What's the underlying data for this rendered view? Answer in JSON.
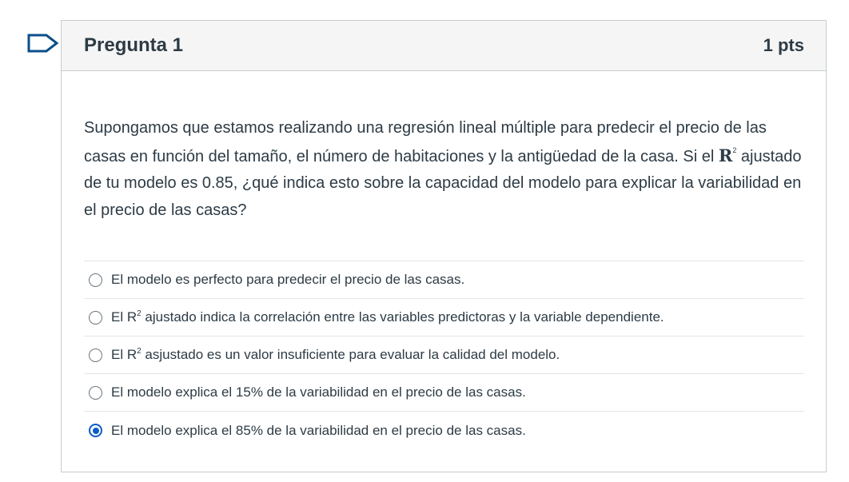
{
  "question": {
    "title": "Pregunta 1",
    "points": "1 pts",
    "text_part1": "Supongamos que estamos realizando una regresión lineal múltiple para predecir el precio de las casas en función del tamaño, el número de habitaciones y la antigüedad de la casa. Si el ",
    "r_symbol": "R",
    "r_superscript": "2",
    "text_part2": " ajustado de tu modelo es 0.85, ¿qué indica esto sobre la capacidad del modelo para explicar la variabilidad en el precio de las casas?"
  },
  "answers": [
    {
      "text": "El modelo es perfecto para predecir el precio de las casas.",
      "selected": false
    },
    {
      "prefix": "El R",
      "superscript": "2",
      "suffix": " ajustado indica la correlación entre las variables predictoras y la variable dependiente.",
      "selected": false
    },
    {
      "prefix": "El R",
      "superscript": "2",
      "suffix": " asjustado es un valor insuficiente para evaluar la calidad del modelo.",
      "selected": false
    },
    {
      "text": "El modelo explica el 15% de la variabilidad en el precio de las casas.",
      "selected": false
    },
    {
      "text": "El modelo explica el 85% de la variabilidad en el precio de las casas.",
      "selected": true
    }
  ],
  "colors": {
    "text": "#2d3b45",
    "header_bg": "#f5f5f5",
    "border": "#c7cdd1",
    "radio_selected": "#0b5cc6",
    "flag": "#0b4f8a"
  },
  "icons": {
    "flag": "bookmark-flag-icon"
  }
}
